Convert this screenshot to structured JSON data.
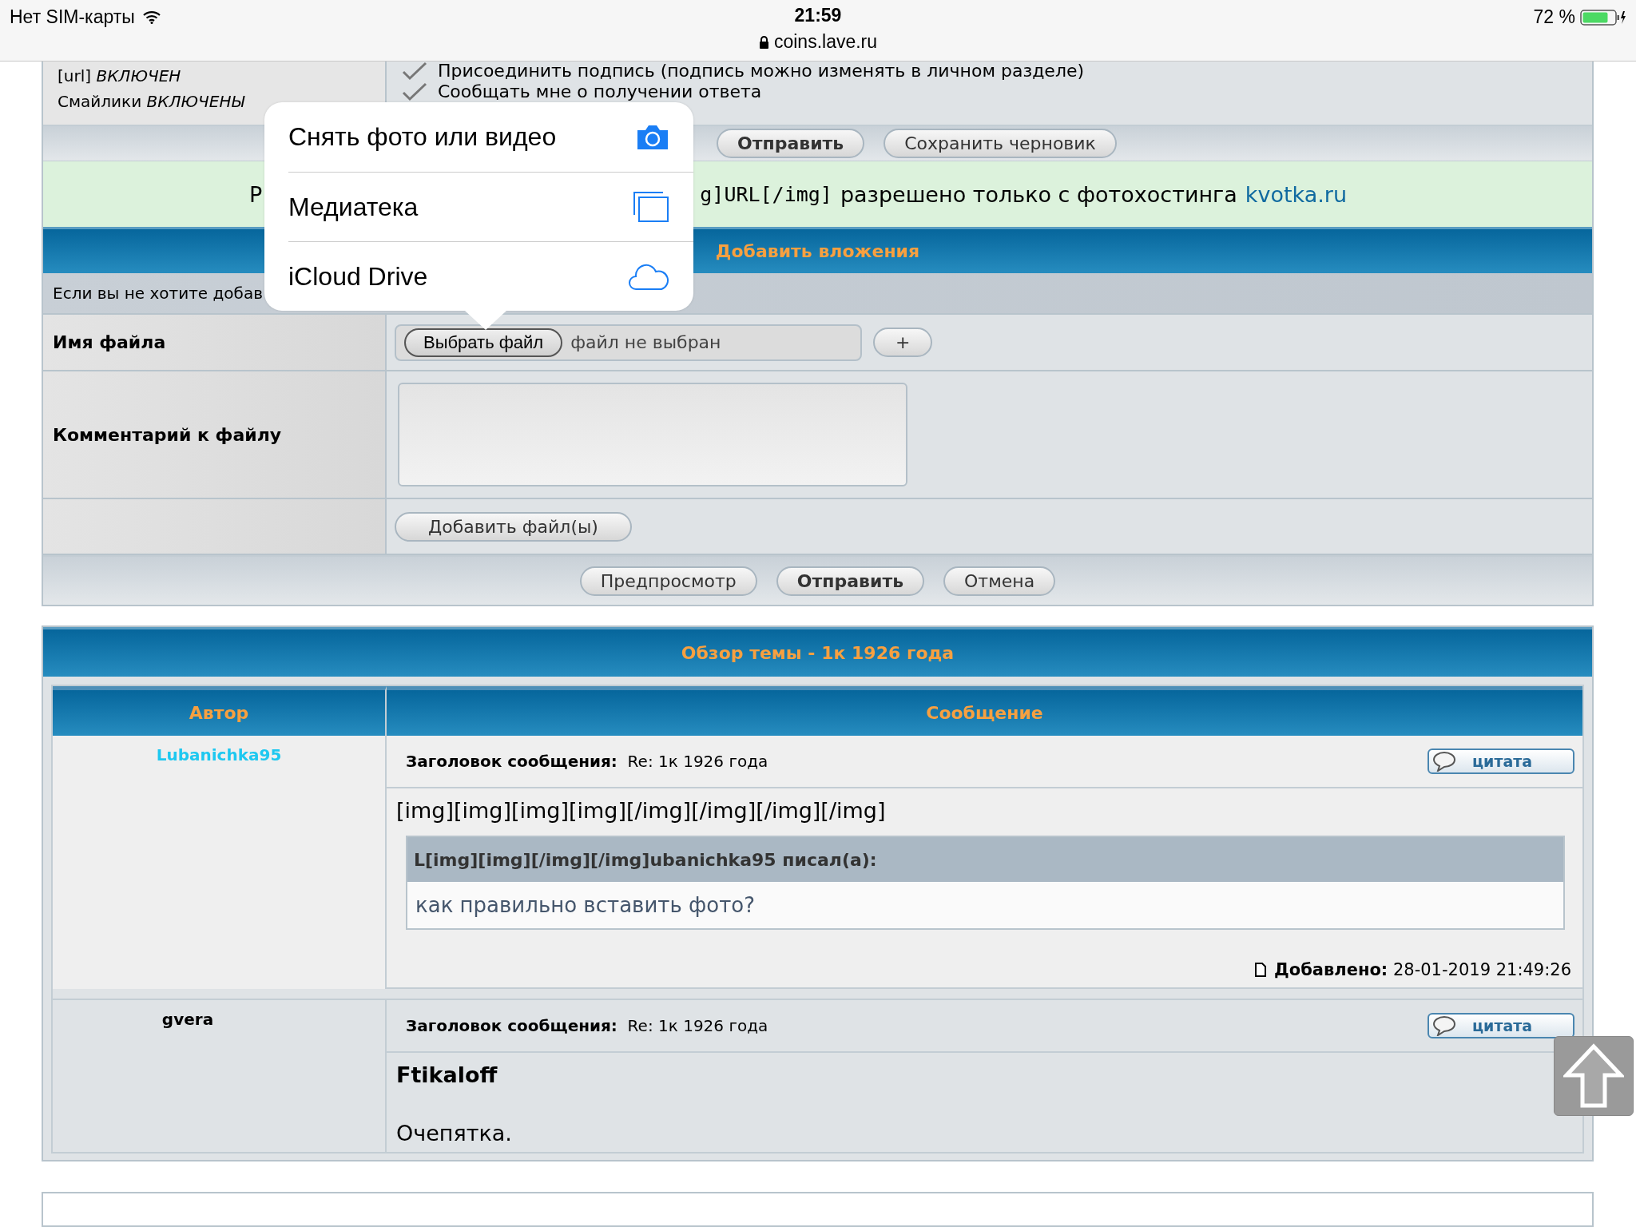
{
  "status_bar": {
    "carrier": "Нет SIM-карты",
    "time": "21:59",
    "url": "coins.lave.ru",
    "battery_text": "72 %"
  },
  "options": {
    "left": [
      {
        "code": "[url]",
        "state": "ВКЛЮЧЕН"
      },
      {
        "code": "Смайлики",
        "state": "ВКЛЮЧЕНЫ"
      }
    ],
    "checks": [
      {
        "label": "Присоединить подпись (подпись можно изменять в личном разделе)",
        "checked": true
      },
      {
        "label": "Сообщать мне о получении ответа",
        "checked": true
      }
    ]
  },
  "form_buttons": [
    {
      "label": "Отправить",
      "primary": true
    },
    {
      "label": "Сохранить черновик",
      "primary": false
    }
  ],
  "notice": {
    "lead": "Р",
    "code": "g]URL[/img]",
    "text": "разрешено только с фотохостинга",
    "link": "kvotka.ru"
  },
  "attachments": {
    "title": "Добавить вложения",
    "hint": "Если вы не хотите добав",
    "file_label": "Имя файла",
    "choose_button": "Выбрать файл",
    "file_status": "файл не выбран",
    "add_row_button": "+",
    "comment_label": "Комментарий к файлу",
    "add_files_button": "Добавить файл(ы)"
  },
  "actions": [
    {
      "label": "Предпросмотр",
      "primary": false
    },
    {
      "label": "Отправить",
      "primary": true
    },
    {
      "label": "Отмена",
      "primary": false
    }
  ],
  "topic_review": {
    "title": "Обзор темы - 1к 1926 года",
    "columns": [
      "Автор",
      "Сообщение"
    ],
    "posts": [
      {
        "author": "Lubanichka95",
        "color": "#1ec8f0",
        "subject_label": "Заголовок сообщения:",
        "subject": "Re: 1к 1926 года",
        "quote_button": "цитата",
        "paragraphs": [
          {
            "text": "[img][img][img][img][/img][/img][/img][/img]",
            "bold": false
          }
        ],
        "quote": {
          "author_line": "L[img][img][/img][/img]ubanichka95 писал(а):",
          "text": "как правильно вставить фото?"
        },
        "footer": {
          "label": "Добавлено:",
          "value": "28-01-2019 21:49:26"
        }
      },
      {
        "author": "gvera",
        "color": "#000000",
        "subject_label": "Заголовок сообщения:",
        "subject": "Re: 1к 1926 года",
        "quote_button": "цитата",
        "paragraphs": [
          {
            "text": "Ftikaloff",
            "bold": true
          },
          {
            "text": "Очепятка.",
            "bold": false
          }
        ]
      }
    ]
  },
  "popover": {
    "items": [
      {
        "label": "Снять фото или видео",
        "kind": "camera"
      },
      {
        "label": "Медиатека",
        "kind": "library"
      },
      {
        "label": "iCloud Drive",
        "kind": "cloud"
      }
    ]
  }
}
